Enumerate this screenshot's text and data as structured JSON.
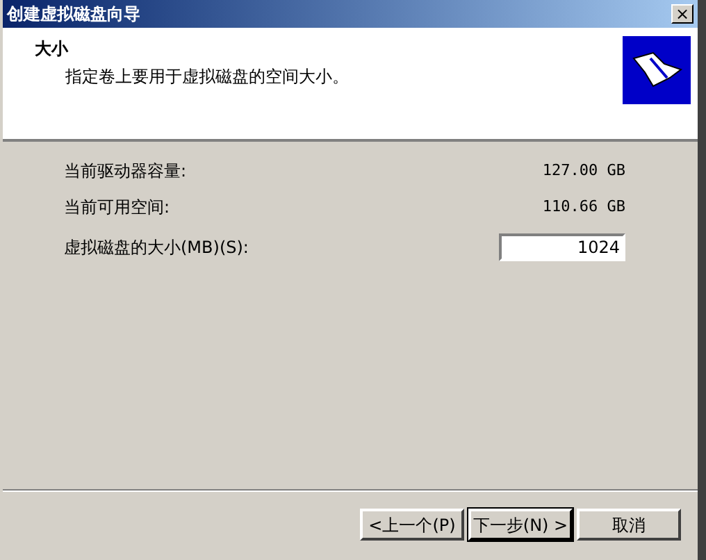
{
  "window": {
    "title": "创建虚拟磁盘向导",
    "close": "×"
  },
  "header": {
    "title": "大小",
    "subtitle": "指定卷上要用于虚拟磁盘的空间大小。"
  },
  "info_rows": [
    {
      "label": "当前驱动器容量:",
      "value": "127.00 GB"
    },
    {
      "label": "当前可用空间:",
      "value": "110.66 GB"
    }
  ],
  "size_field": {
    "label": "虚拟磁盘的大小(MB)(S):",
    "value": "1024"
  },
  "buttons": [
    {
      "label": "<上一个(P)",
      "default": false
    },
    {
      "label": "下一步(N) >",
      "default": true
    },
    {
      "label": "取消",
      "default": false
    }
  ]
}
